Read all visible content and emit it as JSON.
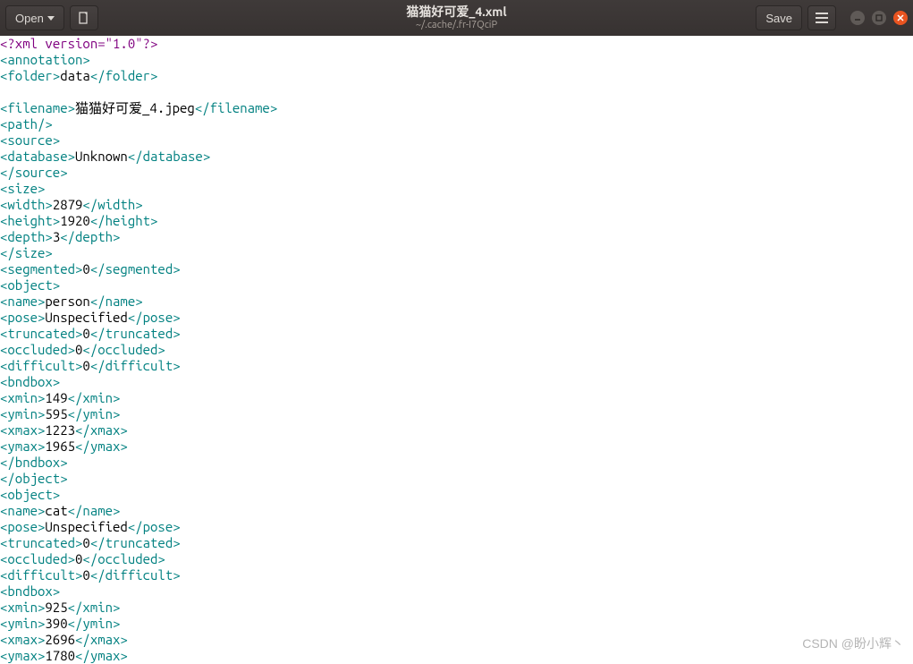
{
  "header": {
    "open_label": "Open",
    "save_label": "Save",
    "title": "猫猫好可爱_4.xml",
    "subtitle": "~/.cache/.fr-I7QciP"
  },
  "xml": {
    "decl_open": "<?xml",
    "decl_attr": " version=\"1.0\"",
    "decl_close": "?>",
    "folder_val": "data",
    "filename_val": "猫猫好可爱_4.jpeg",
    "database_val": "Unknown",
    "width_val": "2879",
    "height_val": "1920",
    "depth_val": "3",
    "segmented_val": "0",
    "obj1": {
      "name": "person",
      "pose": "Unspecified",
      "truncated": "0",
      "occluded": "0",
      "difficult": "0",
      "xmin": "149",
      "ymin": "595",
      "xmax": "1223",
      "ymax": "1965"
    },
    "obj2": {
      "name": "cat",
      "pose": "Unspecified",
      "truncated": "0",
      "occluded": "0",
      "difficult": "0",
      "xmin": "925",
      "ymin": "390",
      "xmax": "2696",
      "ymax": "1780"
    },
    "tags": {
      "annotation_o": "<annotation>",
      "folder_o": "<folder>",
      "folder_c": "</folder>",
      "filename_o": "<filename>",
      "filename_c": "</filename>",
      "path": "<path/>",
      "source_o": "<source>",
      "source_c": "</source>",
      "database_o": "<database>",
      "database_c": "</database>",
      "size_o": "<size>",
      "size_c": "</size>",
      "width_o": "<width>",
      "width_c": "</width>",
      "height_o": "<height>",
      "height_c": "</height>",
      "depth_o": "<depth>",
      "depth_c": "</depth>",
      "segmented_o": "<segmented>",
      "segmented_c": "</segmented>",
      "object_o": "<object>",
      "object_c": "</object>",
      "name_o": "<name>",
      "name_c": "</name>",
      "pose_o": "<pose>",
      "pose_c": "</pose>",
      "truncated_o": "<truncated>",
      "truncated_c": "</truncated>",
      "occluded_o": "<occluded>",
      "occluded_c": "</occluded>",
      "difficult_o": "<difficult>",
      "difficult_c": "</difficult>",
      "bndbox_o": "<bndbox>",
      "bndbox_c": "</bndbox>",
      "xmin_o": "<xmin>",
      "xmin_c": "</xmin>",
      "ymin_o": "<ymin>",
      "ymin_c": "</ymin>",
      "xmax_o": "<xmax>",
      "xmax_c": "</xmax>",
      "ymax_o": "<ymax>",
      "ymax_c": "</ymax>"
    }
  },
  "watermark": "CSDN @盼小辉丶"
}
